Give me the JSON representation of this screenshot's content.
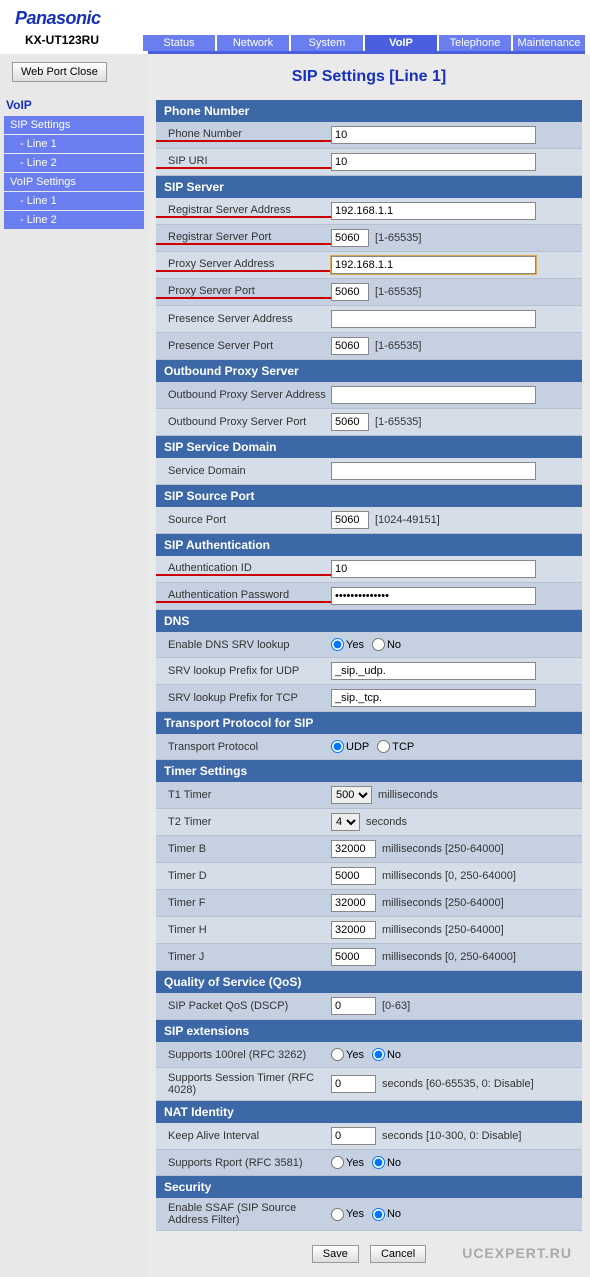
{
  "brand": "Panasonic",
  "model": "KX-UT123RU",
  "tabs": [
    "Status",
    "Network",
    "System",
    "VoIP",
    "Telephone",
    "Maintenance"
  ],
  "activeTab": 3,
  "sidebar": {
    "closeBtn": "Web Port Close",
    "title": "VoIP",
    "items": [
      {
        "label": "SIP Settings",
        "sub": [
          "- Line 1",
          "- Line 2"
        ]
      },
      {
        "label": "VoIP Settings",
        "sub": [
          "- Line 1",
          "- Line 2"
        ]
      }
    ]
  },
  "pageTitle": "SIP Settings [Line 1]",
  "sections": {
    "phoneNumber": {
      "header": "Phone Number",
      "rows": [
        {
          "label": "Phone Number",
          "value": "10",
          "wide": true,
          "ul": true
        },
        {
          "label": "SIP URI",
          "value": "10",
          "wide": true,
          "ul": true
        }
      ]
    },
    "sipServer": {
      "header": "SIP Server",
      "rows": [
        {
          "label": "Registrar Server Address",
          "value": "192.168.1.1",
          "wide": true,
          "ul": true
        },
        {
          "label": "Registrar Server Port",
          "value": "5060",
          "port": true,
          "hint": "[1-65535]",
          "ul": true
        },
        {
          "label": "Proxy Server Address",
          "value": "192.168.1.1",
          "wide": true,
          "ul": true,
          "focus": true
        },
        {
          "label": "Proxy Server Port",
          "value": "5060",
          "port": true,
          "hint": "[1-65535]",
          "ul": true
        },
        {
          "label": "Presence Server Address",
          "value": "",
          "wide": true
        },
        {
          "label": "Presence Server Port",
          "value": "5060",
          "port": true,
          "hint": "[1-65535]"
        }
      ]
    },
    "outbound": {
      "header": "Outbound Proxy Server",
      "rows": [
        {
          "label": "Outbound Proxy Server Address",
          "value": "",
          "wide": true
        },
        {
          "label": "Outbound Proxy Server Port",
          "value": "5060",
          "port": true,
          "hint": "[1-65535]"
        }
      ]
    },
    "domain": {
      "header": "SIP Service Domain",
      "rows": [
        {
          "label": "Service Domain",
          "value": "",
          "wide": true
        }
      ]
    },
    "sourcePort": {
      "header": "SIP Source Port",
      "rows": [
        {
          "label": "Source Port",
          "value": "5060",
          "port": true,
          "hint": "[1024-49151]"
        }
      ]
    },
    "auth": {
      "header": "SIP Authentication",
      "rows": [
        {
          "label": "Authentication ID",
          "value": "10",
          "wide": true,
          "ul": true
        },
        {
          "label": "Authentication Password",
          "value": "••••••••••••••",
          "wide": true,
          "ul": true,
          "pwd": true
        }
      ]
    },
    "dns": {
      "header": "DNS",
      "rows": [
        {
          "label": "Enable DNS SRV lookup",
          "radio": true,
          "opts": [
            "Yes",
            "No"
          ],
          "sel": 0
        },
        {
          "label": "SRV lookup Prefix for UDP",
          "value": "_sip._udp.",
          "wide": true
        },
        {
          "label": "SRV lookup Prefix for TCP",
          "value": "_sip._tcp.",
          "wide": true
        }
      ]
    },
    "transport": {
      "header": "Transport Protocol for SIP",
      "rows": [
        {
          "label": "Transport Protocol",
          "radio": true,
          "opts": [
            "UDP",
            "TCP"
          ],
          "sel": 0
        }
      ]
    },
    "timer": {
      "header": "Timer Settings",
      "rows": [
        {
          "label": "T1 Timer",
          "select": true,
          "value": "500",
          "hint": "milliseconds"
        },
        {
          "label": "T2 Timer",
          "select": true,
          "value": "4",
          "hint": "seconds"
        },
        {
          "label": "Timer B",
          "value": "32000",
          "num": true,
          "hint": "milliseconds [250-64000]"
        },
        {
          "label": "Timer D",
          "value": "5000",
          "num": true,
          "hint": "milliseconds [0, 250-64000]"
        },
        {
          "label": "Timer F",
          "value": "32000",
          "num": true,
          "hint": "milliseconds [250-64000]"
        },
        {
          "label": "Timer H",
          "value": "32000",
          "num": true,
          "hint": "milliseconds [250-64000]"
        },
        {
          "label": "Timer J",
          "value": "5000",
          "num": true,
          "hint": "milliseconds [0, 250-64000]"
        }
      ]
    },
    "qos": {
      "header": "Quality of Service (QoS)",
      "rows": [
        {
          "label": "SIP Packet QoS (DSCP)",
          "value": "0",
          "num": true,
          "hint": "[0-63]"
        }
      ]
    },
    "ext": {
      "header": "SIP extensions",
      "rows": [
        {
          "label": "Supports 100rel (RFC 3262)",
          "radio": true,
          "opts": [
            "Yes",
            "No"
          ],
          "sel": 1
        },
        {
          "label": "Supports Session Timer (RFC 4028)",
          "value": "0",
          "num": true,
          "hint": "seconds [60-65535, 0: Disable]"
        }
      ]
    },
    "nat": {
      "header": "NAT Identity",
      "rows": [
        {
          "label": "Keep Alive Interval",
          "value": "0",
          "num": true,
          "hint": "seconds [10-300, 0: Disable]"
        },
        {
          "label": "Supports Rport (RFC 3581)",
          "radio": true,
          "opts": [
            "Yes",
            "No"
          ],
          "sel": 1
        }
      ]
    },
    "security": {
      "header": "Security",
      "rows": [
        {
          "label": "Enable SSAF (SIP Source Address Filter)",
          "radio": true,
          "opts": [
            "Yes",
            "No"
          ],
          "sel": 1
        }
      ]
    }
  },
  "buttons": {
    "save": "Save",
    "cancel": "Cancel"
  },
  "watermark": "UCEXPERT.RU"
}
